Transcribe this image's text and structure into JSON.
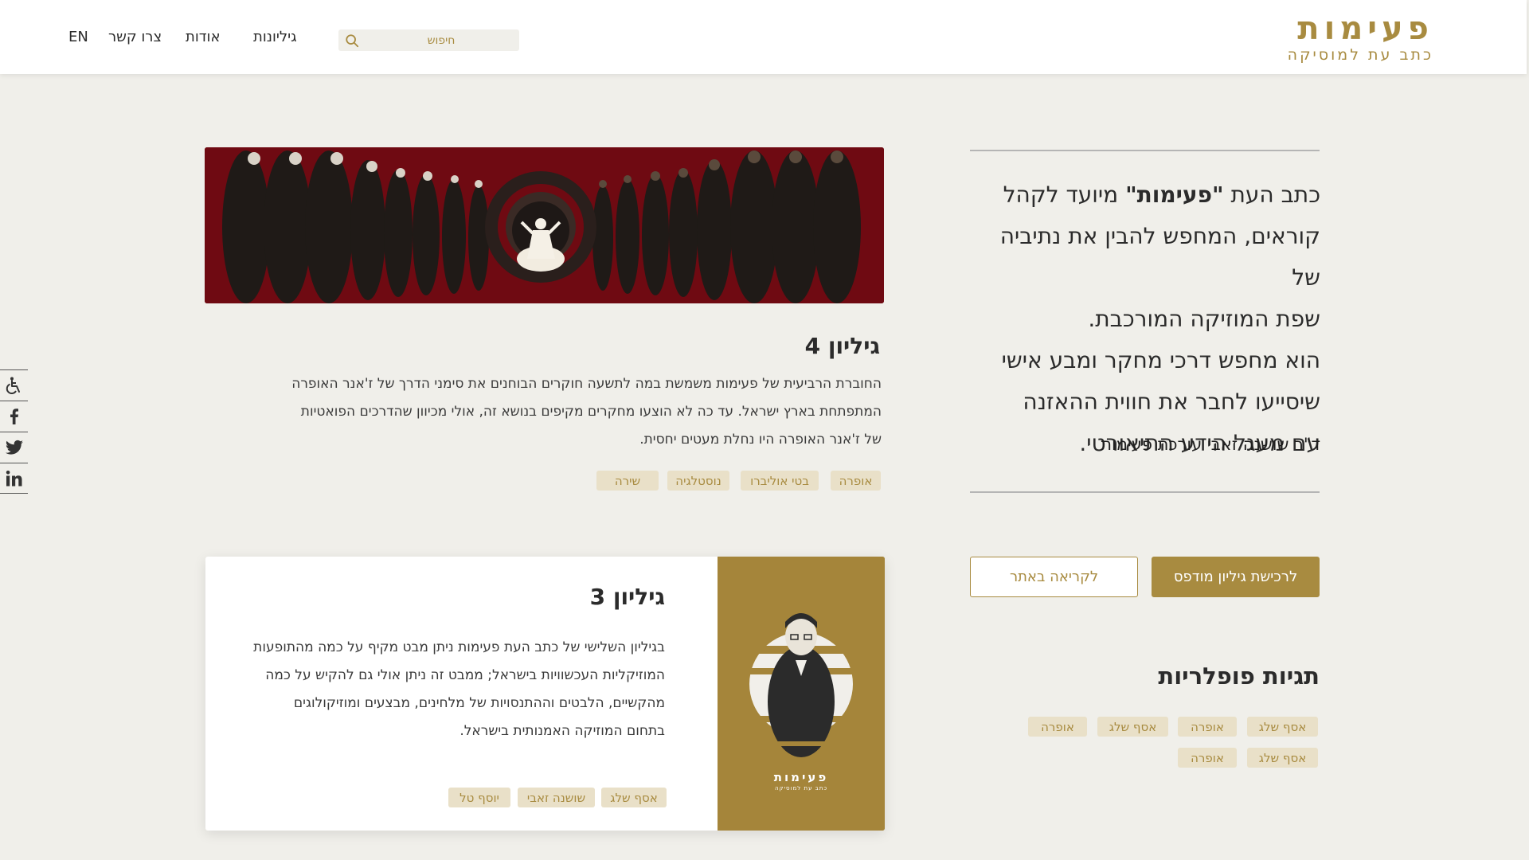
{
  "header": {
    "logo_title": "פעימות",
    "logo_subtitle": "כתב עת למוסיקה",
    "search_placeholder": "חיפוש",
    "nav": {
      "issues": "גיליונות",
      "about": "אודות",
      "contact": "צרו קשר",
      "language": "EN"
    }
  },
  "social": [
    "accessibility-icon",
    "facebook-icon",
    "twitter-icon",
    "linkedin-icon"
  ],
  "intro": {
    "line1_pre": "כתב העת ",
    "line1_bold": "\"פעימות\"",
    "line1_post": " מיועד לקהל",
    "line2": "קוראים, המחפש להבין את נתיביה של",
    "line3": "שפת המוזיקה המורכבת.",
    "line4": "הוא מחפש דרכי מחקר ומבע אישי",
    "line5": "שיסייעו לחבר את חווית ההאזנה",
    "line6": "עם מעגל הידע התיאורטי.",
    "editor": "ד\"ר שושנה זאבי עורכת פעימות"
  },
  "buttons": {
    "buy_print": "לרכישת גיליון מודפס",
    "read_online": "לקריאה באתר"
  },
  "popular_tags": {
    "title": "תגיות פופלריות",
    "tags": [
      "אסף שלג",
      "אופרה",
      "אסף שלג",
      "אופרה",
      "אסף שלג",
      "אופרה"
    ]
  },
  "issue4": {
    "title": "גיליון  4",
    "line1": "החוברת הרביעית של פעימות משמשת במה לתשעה חוקרים הבוחנים את סימני הדרך של ז'אנר האופרה",
    "line2": "המתפתחת בארץ ישראל. עד כה לא הוצעו מחקרים מקיפים בנושא זה, אולי מכיוון שהדרכים הפואטיות",
    "line3": "של ז'אנר האופרה היו נחלת מעטים יחסית.",
    "tags": [
      "אופרה",
      "בטי אוליברו",
      "נוסטלגיה",
      "שירה"
    ]
  },
  "issue3": {
    "title": "גיליון 3",
    "line1": "בגיליון השלישי של כתב העת פעימות ניתן מבט מקיף על כמה מהתופעות",
    "line2": "המוזיקליות העכשוויות בישראל; ממבט זה ניתן אולי גם להקיש על כמה",
    "line3": "מהקשיים, הלבטים וההתנסויות של מלחינים, מבצעים ומוזיקולוגים",
    "line4": "בתחום המוזיקה האמנותית בישראל.",
    "cover_title": "פעימות",
    "cover_subtitle": "כתב עת למוסיקה",
    "tags": [
      "אסף שלג",
      "שושנה זאבי",
      "יוסף טל"
    ]
  },
  "colors": {
    "accent": "#a88b40",
    "background": "#f0efea",
    "banner": "#6f0a12",
    "tag_bg": "#e9e0c8"
  }
}
